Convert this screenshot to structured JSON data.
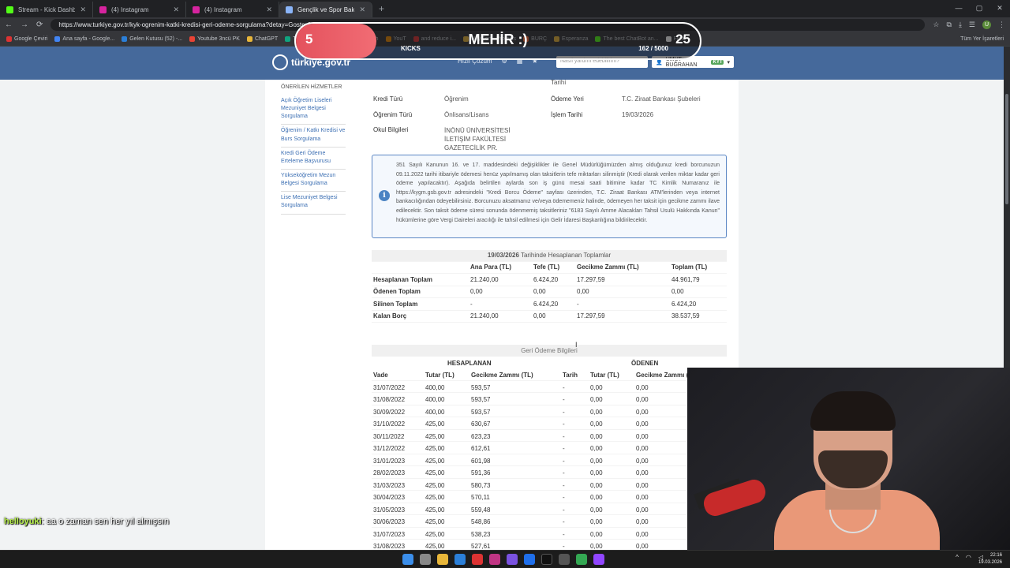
{
  "browser": {
    "tabs": [
      {
        "title": "Stream - Kick Dashboard",
        "color": "#53fc18"
      },
      {
        "title": "(4) Instagram",
        "color": "#d6249f"
      },
      {
        "title": "(4) Instagram",
        "color": "#d6249f"
      },
      {
        "title": "Gençlik ve Spor Bakanlığı - Öğ",
        "color": "#8ab4f8"
      }
    ],
    "url": "https://www.turkiye.gov.tr/kyk-ogrenim-katki-kredisi-geri-odeme-sorgulama?detay=Goster&distinct",
    "bookmarks": [
      "Google Çeviri",
      "Ana sayfa - Google...",
      "Gelen Kutusu (52) -...",
      "Youtube 3ncü PK",
      "ChatGPT",
      "Transcript of \"MI M...",
      "türkçe h",
      "YouT",
      "and reduce i...",
      "HeyGen - Projects",
      "BURÇ",
      "Esperanza",
      "The best ChatBot an...",
      "Flow"
    ],
    "all_bookmarks": "Tüm Yer İşaretleri",
    "profile_initial": "U"
  },
  "gov": {
    "logo": "türkiye.gov.tr",
    "menu": [
      "Hızlı Çözüm"
    ],
    "search_placeholder": "Nasıl yardım edebilirim?",
    "user": "UMUT BUĞRAHAN",
    "user_badge": "KYT"
  },
  "sidebar": {
    "title": "ÖNERİLEN HİZMETLER",
    "links": [
      "Açık Öğretim Liseleri Mezuniyet Belgesi Sorgulama",
      "Öğrenim / Katkı Kredisi ve Burs Sorgulama",
      "Kredi Geri Ödeme Erteleme Başvurusu",
      "Yükseköğretim Mezun Belgesi Sorgulama",
      "Lise Mezuniyet Belgesi Sorgulama"
    ]
  },
  "summary": {
    "top_right_label": "Tarihi",
    "rows": [
      {
        "k1": "Kredi Türü",
        "v1": "Öğrenim",
        "k2": "Ödeme Yeri",
        "v2": "T.C. Ziraat Bankası Şubeleri"
      },
      {
        "k1": "Öğrenim Türü",
        "v1": "Önlisans/Lisans",
        "k2": "İşlem Tarihi",
        "v2": "19/03/2026"
      },
      {
        "k1": "Okul Bilgileri",
        "v1": "İNÖNÜ ÜNİVERSİTESİ İLETİŞİM FAKÜLTESİ GAZETECİLİK PR.",
        "k2": "",
        "v2": ""
      }
    ]
  },
  "info_text": "351 Sayılı Kanunun 16. ve 17. maddesindeki değişiklikler ile Genel Müdürlüğümüzden almış olduğunuz kredi borcunuzun 09.11.2022 tarihi itibariyle ödemesi henüz yapılmamış olan taksitlerin tefe miktarları silinmiştir (Kredi olarak verilen miktar kadar geri ödeme yapılacaktır). Aşağıda belirtilen aylarda son iş günü mesai saati bitimine kadar TC Kimlik Numaranız ile https://kygm.gsb.gov.tr adresindeki \"Kredi Borcu Ödeme\" sayfası üzerinden, T.C. Ziraat Bankası ATM'lerinden veya internet bankacılığından ödeyebilirsiniz. Borcunuzu aksatmanız ve/veya ödememeniz halinde, ödemeyen her taksit için gecikme zammı ilave edilecektir. Son taksit ödeme süresi sonunda ödenmemiş taksitleriniz \"6183 Sayılı Amme Alacakları Tahsil Usulü Hakkında Kanun\" hükümlerine göre Vergi Daireleri aracılığı ile tahsil edilmesi için Gelir İdaresi Başkanlığına bildirilecektir.",
  "totals": {
    "caption_date": "19/03/2026",
    "caption_rest": " Tarihinde Hesaplanan Toplamlar",
    "headers": [
      "",
      "Ana Para (TL)",
      "Tefe (TL)",
      "Gecikme Zammı (TL)",
      "Toplam (TL)"
    ],
    "rows": [
      [
        "Hesaplanan Toplam",
        "21.240,00",
        "6.424,20",
        "17.297,59",
        "44.961,79"
      ],
      [
        "Ödenen Toplam",
        "0,00",
        "0,00",
        "0,00",
        "0,00"
      ],
      [
        "Silinen Toplam",
        "-",
        "6.424,20",
        "-",
        "6.424,20"
      ],
      [
        "Kalan Borç",
        "21.240,00",
        "0,00",
        "17.297,59",
        "38.537,59"
      ]
    ]
  },
  "payments": {
    "caption": "Geri Ödeme Bilgileri",
    "group_left": "HESAPLANAN",
    "group_right": "ÖDENEN",
    "headers": [
      "Vade",
      "Tutar (TL)",
      "Gecikme Zammı (TL)",
      "Tarih",
      "Tutar (TL)",
      "Gecikme Zammı (T"
    ],
    "rows": [
      [
        "31/07/2022",
        "400,00",
        "593,57",
        "-",
        "0,00",
        "0,00"
      ],
      [
        "31/08/2022",
        "400,00",
        "593,57",
        "-",
        "0,00",
        "0,00"
      ],
      [
        "30/09/2022",
        "400,00",
        "593,57",
        "-",
        "0,00",
        "0,00"
      ],
      [
        "31/10/2022",
        "425,00",
        "630,67",
        "-",
        "0,00",
        "0,00"
      ],
      [
        "30/11/2022",
        "425,00",
        "623,23",
        "-",
        "0,00",
        "0,00"
      ],
      [
        "31/12/2022",
        "425,00",
        "612,61",
        "-",
        "0,00",
        "0,00"
      ],
      [
        "31/01/2023",
        "425,00",
        "601,98",
        "-",
        "0,00",
        "0,00"
      ],
      [
        "28/02/2023",
        "425,00",
        "591,36",
        "-",
        "0,00",
        "0,00"
      ],
      [
        "31/03/2023",
        "425,00",
        "580,73",
        "-",
        "0,00",
        "0,00"
      ],
      [
        "30/04/2023",
        "425,00",
        "570,11",
        "-",
        "0,00",
        "0,00"
      ],
      [
        "31/05/2023",
        "425,00",
        "559,48",
        "-",
        "0,00",
        "0,00"
      ],
      [
        "30/06/2023",
        "425,00",
        "548,86",
        "-",
        "0,00",
        "0,00"
      ],
      [
        "31/07/2023",
        "425,00",
        "538,23",
        "-",
        "0,00",
        "0,00"
      ],
      [
        "31/08/2023",
        "425,00",
        "527,61",
        "-",
        "0,00",
        "0,00"
      ]
    ]
  },
  "kicks_overlay": {
    "current": "5",
    "title": "MEHİR :)",
    "goal": "25",
    "label": "KICKS",
    "count": "162 / 5000",
    "progress": 0.2
  },
  "chat": {
    "user": "helloyuki",
    "message": ": aa o zaman sen her yıl almışsın"
  },
  "clock": {
    "time": "22:16",
    "date": "19.03.2026"
  }
}
